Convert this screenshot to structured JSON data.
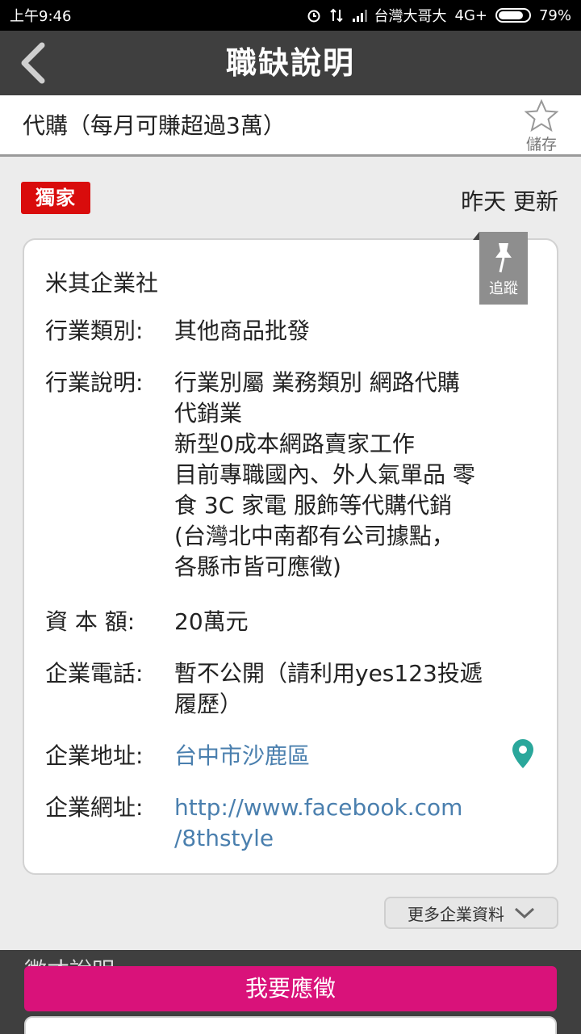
{
  "status_bar": {
    "time": "上午9:46",
    "carrier": "台灣大哥大",
    "network": "4G+",
    "battery": "79%"
  },
  "header": {
    "title": "職缺說明",
    "back_icon": "chevron-left-icon"
  },
  "job": {
    "title": "代購（每月可賺超過3萬）",
    "save_label": "儲存",
    "save_icon": "star-outline-icon"
  },
  "meta": {
    "badge": "獨家",
    "updated": "昨天 更新"
  },
  "company": {
    "name": "米其企業社",
    "track_label": "追蹤",
    "fields": {
      "industry": {
        "label": "行業類別:",
        "value": "其他商品批發"
      },
      "description": {
        "label": "行業說明:",
        "lines": [
          "行業別屬 業務類別 網路代購",
          "代銷業",
          "新型0成本網路賣家工作",
          "目前專職國內、外人氣單品 零",
          "食 3C 家電 服飾等代購代銷",
          "(台灣北中南都有公司據點，",
          "各縣市皆可應徵)"
        ]
      },
      "capital": {
        "label": "資 本 額:",
        "value": "20萬元"
      },
      "phone": {
        "label": "企業電話:",
        "lines": [
          "暫不公開（請利用yes123投遞",
          "履歷）"
        ]
      },
      "address": {
        "label": "企業地址:",
        "value": "台中市沙鹿區"
      },
      "website": {
        "label": "企業網址:",
        "lines": [
          "http://www.facebook.com",
          "/8thstyle"
        ]
      }
    },
    "more_button": "更多企業資料"
  },
  "bottom": {
    "section_peek": "徵才說明",
    "apply_button": "我要應徵"
  },
  "colors": {
    "header_bg": "#3f3f3f",
    "badge_red": "#d90c0c",
    "link_blue": "#4a7fae",
    "apply_pink": "#d9127a",
    "location_teal": "#2aa79b"
  }
}
